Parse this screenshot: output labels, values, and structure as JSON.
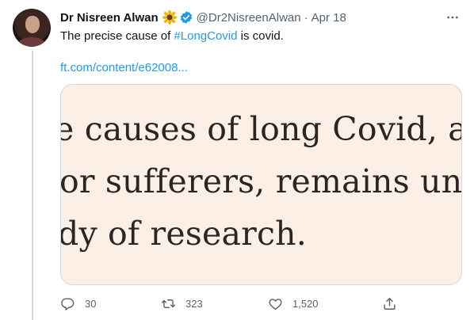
{
  "tweet": {
    "author_name": "Dr Nisreen Alwan",
    "author_emoji": "sunflower-emoji",
    "verified_icon": "verified-badge-icon",
    "handle": "@Dr2NisreenAlwan",
    "separator": "·",
    "date": "Apr 18",
    "text_before": "The precise cause of ",
    "hashtag": "#LongCovid",
    "text_after": " is covid.",
    "link": "ft.com/content/e62008..."
  },
  "media": {
    "lines": [
      "e causes of long Covid, and t",
      "or sufferers, remains unclea",
      "dy of research."
    ],
    "background": "#fcefe5"
  },
  "actions": {
    "reply": {
      "icon": "reply-icon",
      "count": "30"
    },
    "retweet": {
      "icon": "retweet-icon",
      "count": "323"
    },
    "like": {
      "icon": "heart-icon",
      "count": "1,520"
    },
    "share": {
      "icon": "share-icon"
    }
  },
  "colors": {
    "accent": "#1d9bf0",
    "muted": "#536471",
    "text": "#0f1419"
  }
}
